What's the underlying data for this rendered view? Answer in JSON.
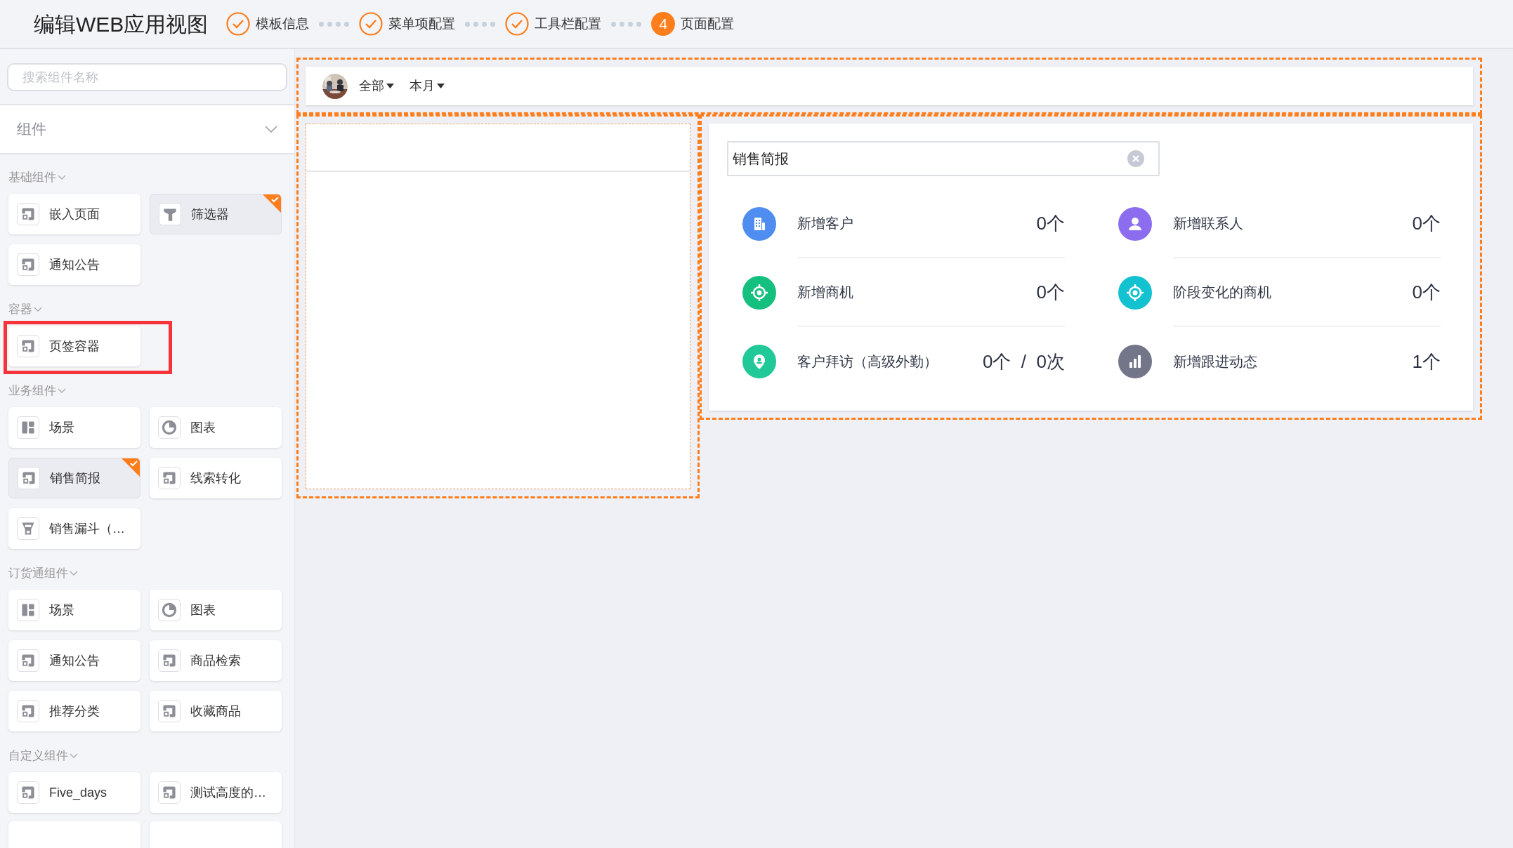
{
  "header": {
    "title": "编辑WEB应用视图",
    "steps": [
      {
        "label": "模板信息",
        "kind": "done"
      },
      {
        "label": "菜单项配置",
        "kind": "done"
      },
      {
        "label": "工具栏配置",
        "kind": "done"
      },
      {
        "label": "页面配置",
        "kind": "current",
        "number": "4"
      }
    ]
  },
  "sidebar": {
    "search": {
      "placeholder": "搜索组件名称"
    },
    "panel_title": "组件",
    "groups": [
      {
        "title": "基础组件",
        "items": [
          {
            "label": "嵌入页面",
            "kind": "embed",
            "selected": false
          },
          {
            "label": "筛选器",
            "kind": "filter",
            "selected": true
          },
          {
            "label": "通知公告",
            "kind": "embed",
            "selected": false
          }
        ]
      },
      {
        "title": "容器",
        "items": [
          {
            "label": "页签容器",
            "kind": "embed",
            "selected": false,
            "highlighted": true
          }
        ]
      },
      {
        "title": "业务组件",
        "items": [
          {
            "label": "场景",
            "kind": "layout",
            "selected": false
          },
          {
            "label": "图表",
            "kind": "chart",
            "selected": false
          },
          {
            "label": "销售简报",
            "kind": "embed",
            "selected": true
          },
          {
            "label": "线索转化",
            "kind": "embed",
            "selected": false
          },
          {
            "label": "销售漏斗（…",
            "kind": "funnel",
            "selected": false
          }
        ]
      },
      {
        "title": "订货通组件",
        "items": [
          {
            "label": "场景",
            "kind": "layout",
            "selected": false
          },
          {
            "label": "图表",
            "kind": "chart",
            "selected": false
          },
          {
            "label": "通知公告",
            "kind": "embed",
            "selected": false
          },
          {
            "label": "商品检索",
            "kind": "embed",
            "selected": false
          },
          {
            "label": "推荐分类",
            "kind": "embed",
            "selected": false
          },
          {
            "label": "收藏商品",
            "kind": "embed",
            "selected": false
          }
        ]
      },
      {
        "title": "自定义组件",
        "items": [
          {
            "label": "Five_days",
            "kind": "embed",
            "selected": false
          },
          {
            "label": "测试高度的…",
            "kind": "embed",
            "selected": false
          }
        ]
      }
    ]
  },
  "toolbar": {
    "filters": [
      "全部",
      "本月"
    ]
  },
  "sales_brief": {
    "title_field": {
      "value": "销售简报"
    },
    "stats": [
      {
        "label": "新增客户",
        "value": "0个",
        "kind": "building",
        "color": "#4f8ef0"
      },
      {
        "label": "新增联系人",
        "value": "0个",
        "kind": "person",
        "color": "#8c6df0"
      },
      {
        "label": "新增商机",
        "value": "0个",
        "kind": "target",
        "color": "#15c07f"
      },
      {
        "label": "阶段变化的商机",
        "value": "0个",
        "kind": "target",
        "color": "#13c2d0"
      },
      {
        "label": "客户拜访（高级外勤）",
        "value": "0个  /  0次",
        "kind": "pin",
        "color": "#20c997"
      },
      {
        "label": "新增跟进动态",
        "value": "1个",
        "kind": "bars",
        "color": "#737689"
      }
    ]
  }
}
